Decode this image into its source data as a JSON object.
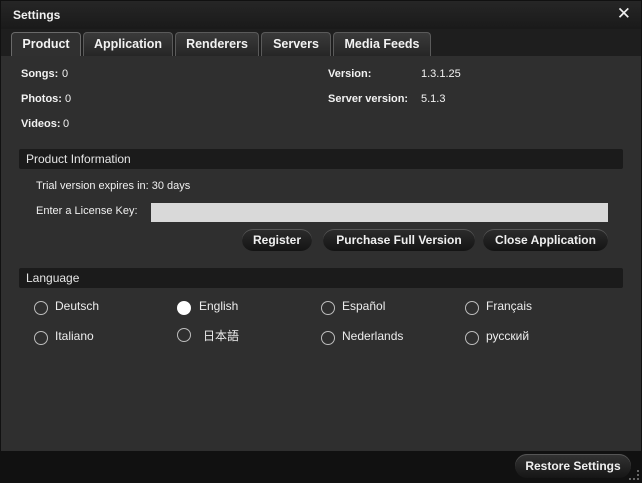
{
  "window": {
    "title": "Settings",
    "close_glyph": "✕"
  },
  "tabs": [
    {
      "label": "Product",
      "active": true
    },
    {
      "label": "Application",
      "active": false
    },
    {
      "label": "Renderers",
      "active": false
    },
    {
      "label": "Servers",
      "active": false
    },
    {
      "label": "Media Feeds",
      "active": false
    }
  ],
  "stats": {
    "songs_label": "Songs:",
    "songs_value": "0",
    "photos_label": "Photos:",
    "photos_value": "0",
    "videos_label": "Videos:",
    "videos_value": "0",
    "version_label": "Version:",
    "version_value": "1.3.1.25",
    "server_version_label": "Server version:",
    "server_version_value": "5.1.3"
  },
  "product_info": {
    "header": "Product Information",
    "trial_text": "Trial version expires in: 30 days",
    "license_label": "Enter a License Key:",
    "license_value": "",
    "register_label": "Register",
    "purchase_label": "Purchase Full Version",
    "close_app_label": "Close Application"
  },
  "language": {
    "header": "Language",
    "options": [
      {
        "label": "Deutsch",
        "checked": false
      },
      {
        "label": "English",
        "checked": true
      },
      {
        "label": "Español",
        "checked": false
      },
      {
        "label": "Français",
        "checked": false
      },
      {
        "label": "Italiano",
        "checked": false
      },
      {
        "label": "日本語",
        "checked": false
      },
      {
        "label": "Nederlands",
        "checked": false
      },
      {
        "label": "русский",
        "checked": false
      }
    ]
  },
  "footer": {
    "restore_label": "Restore Settings"
  }
}
